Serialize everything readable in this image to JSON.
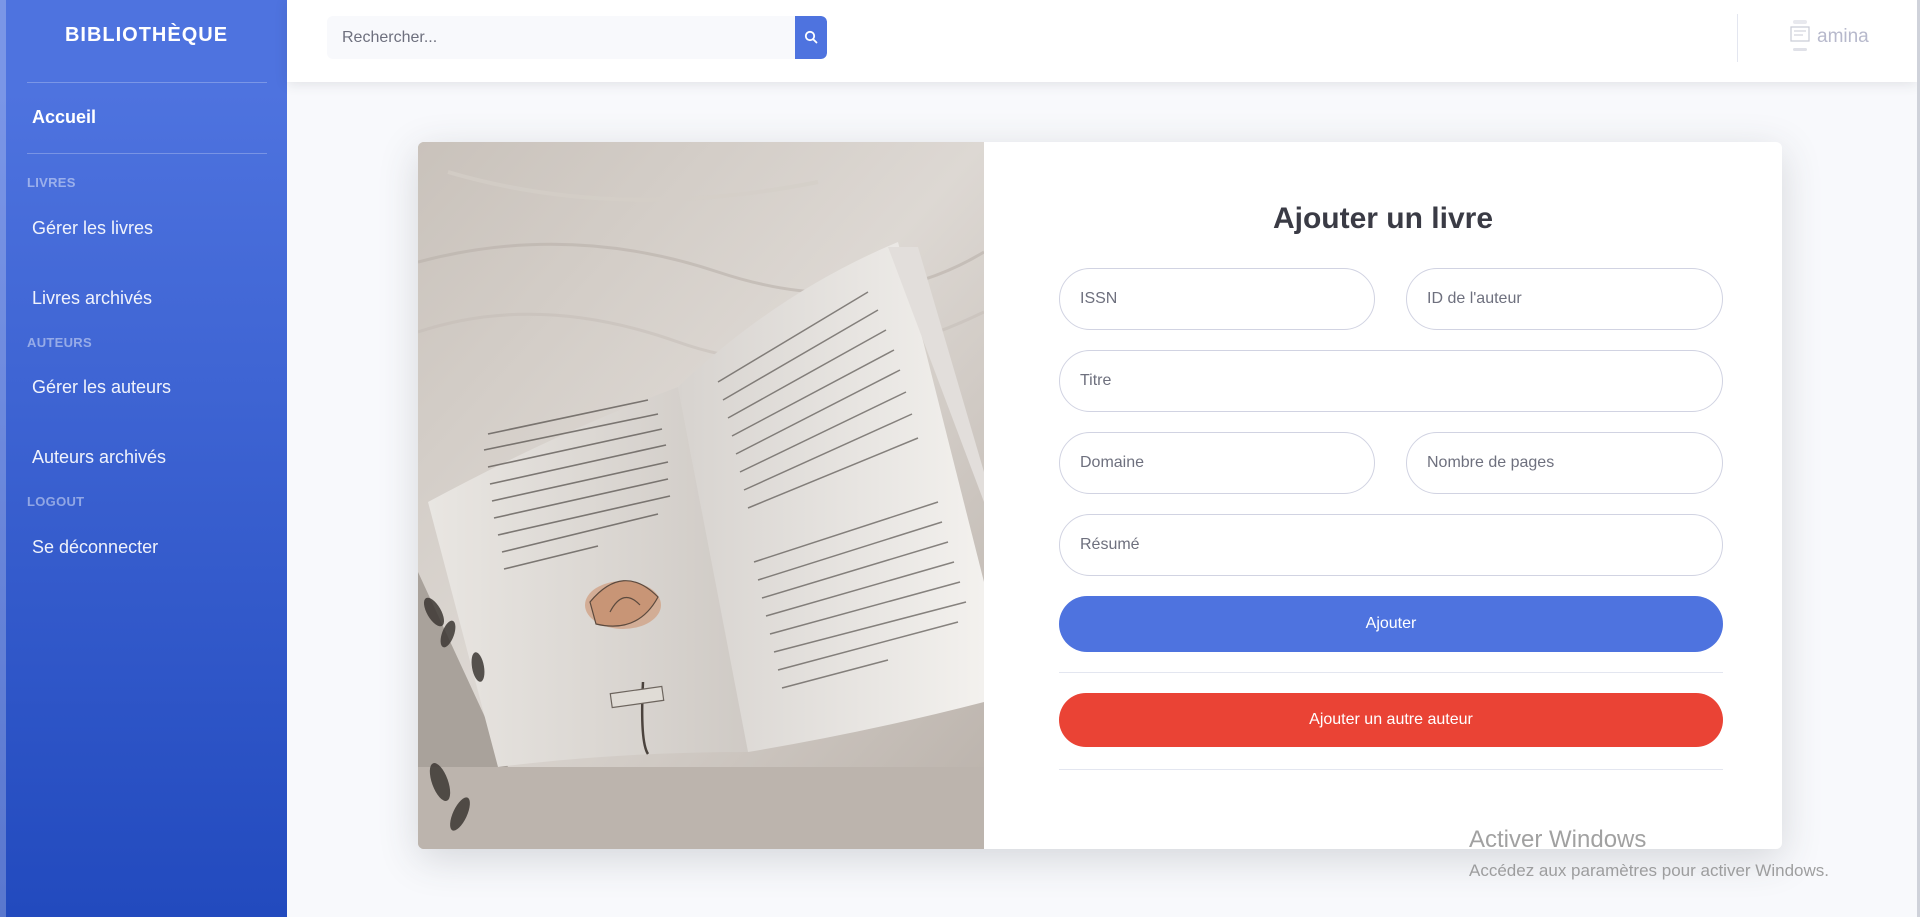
{
  "sidebar": {
    "brand": "BIBLIOTHÈQUE",
    "items": [
      {
        "label": "Accueil"
      },
      {
        "section": "LIVRES"
      },
      {
        "label": "Gérer les livres"
      },
      {
        "label": "Livres archivés"
      },
      {
        "section": "AUTEURS"
      },
      {
        "label": "Gérer les auteurs"
      },
      {
        "label": "Auteurs archivés"
      },
      {
        "section": "LOGOUT"
      },
      {
        "label": "Se déconnecter"
      }
    ]
  },
  "topbar": {
    "search_placeholder": "Rechercher...",
    "user_name": "amina"
  },
  "form": {
    "title": "Ajouter un livre",
    "fields": {
      "issn": "ISSN",
      "author_id": "ID de l'auteur",
      "titre": "Titre",
      "domaine": "Domaine",
      "pages": "Nombre de pages",
      "resume": "Résumé"
    },
    "submit_label": "Ajouter",
    "add_author_label": "Ajouter un autre auteur"
  },
  "watermark": {
    "title": "Activer Windows",
    "subtitle": "Accédez aux paramètres pour activer Windows."
  },
  "colors": {
    "primary": "#4e73df",
    "danger": "#ea4335",
    "background": "#f8f9fc"
  }
}
